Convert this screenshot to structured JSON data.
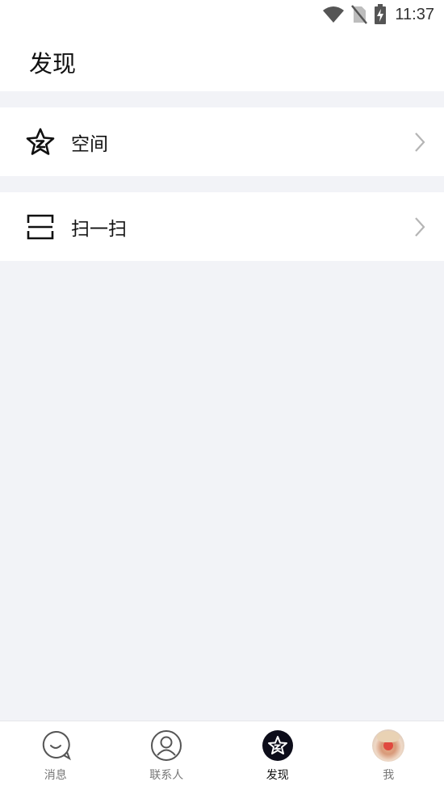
{
  "status_bar": {
    "time": "11:37"
  },
  "header": {
    "title": "发现"
  },
  "menu": [
    {
      "label": "空间",
      "icon": "star-icon"
    },
    {
      "label": "扫一扫",
      "icon": "scan-icon"
    }
  ],
  "tabbar": {
    "items": [
      {
        "label": "消息",
        "icon": "chat-bubble-icon",
        "active": false
      },
      {
        "label": "联系人",
        "icon": "contact-person-icon",
        "active": false
      },
      {
        "label": "发现",
        "icon": "discover-star-icon",
        "active": true
      },
      {
        "label": "我",
        "icon": "avatar",
        "active": false
      }
    ]
  },
  "colors": {
    "background": "#f2f3f7",
    "card": "#ffffff",
    "text": "#111111",
    "tab_inactive": "#777777"
  }
}
